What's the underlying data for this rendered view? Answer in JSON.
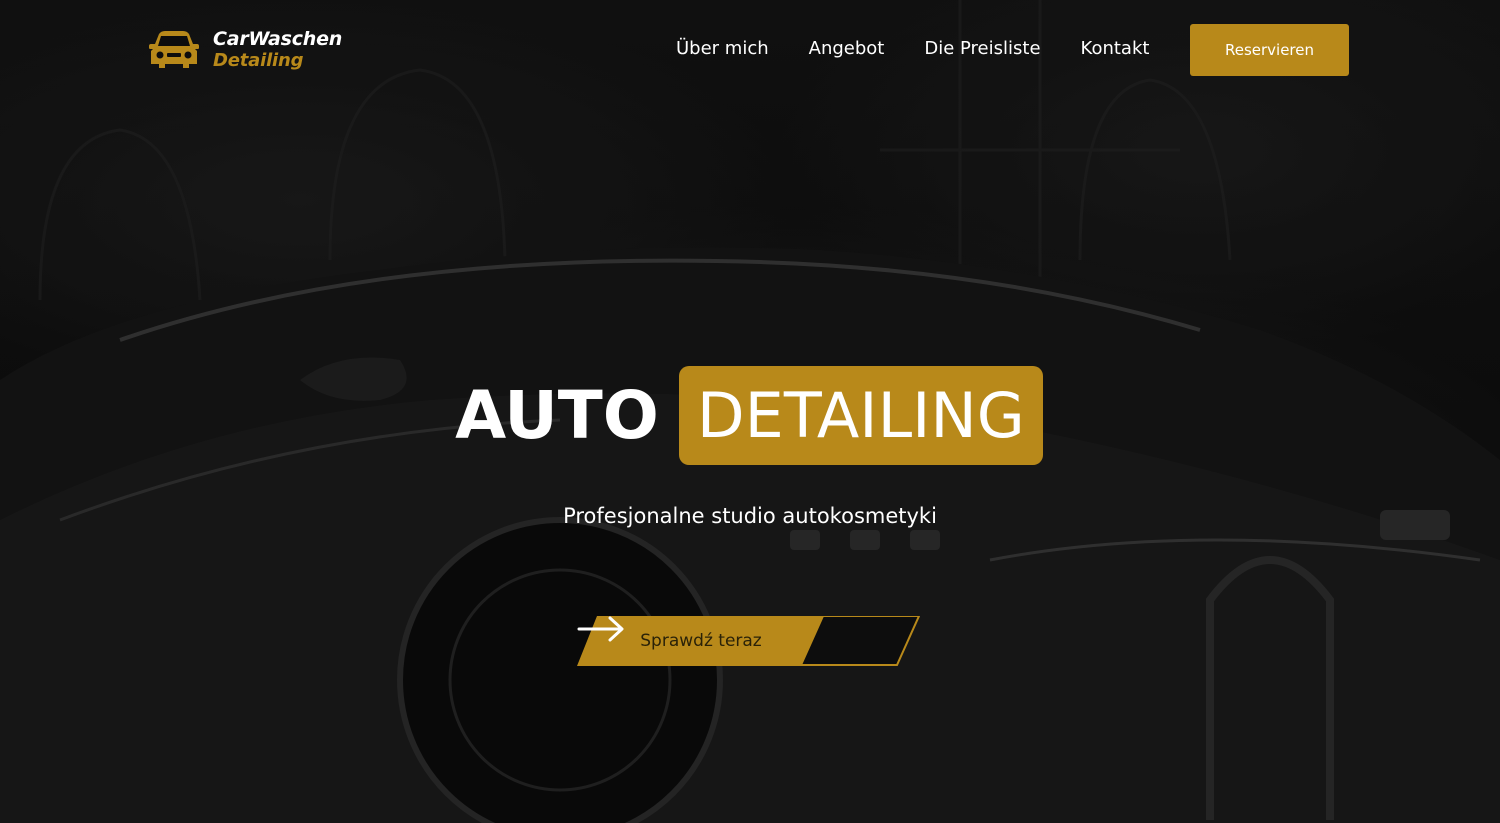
{
  "brand": {
    "name_line1": "CarWaschen",
    "name_line2": "Detailing",
    "logo_icon": "car-icon",
    "accent_color": "#b8891a"
  },
  "nav": {
    "items": [
      {
        "label": "Über mich"
      },
      {
        "label": "Angebot"
      },
      {
        "label": "Die Preisliste"
      },
      {
        "label": "Kontakt"
      }
    ],
    "cta_label": "Reservieren"
  },
  "hero": {
    "title_plain": "AUTO",
    "title_highlight": "DETAILING",
    "subtitle": "Profesjonalne studio autokosmetyki",
    "cta_label": "Sprawdź teraz",
    "cta_icon": "arrow-right-icon",
    "background": "dark luxury car photo"
  }
}
